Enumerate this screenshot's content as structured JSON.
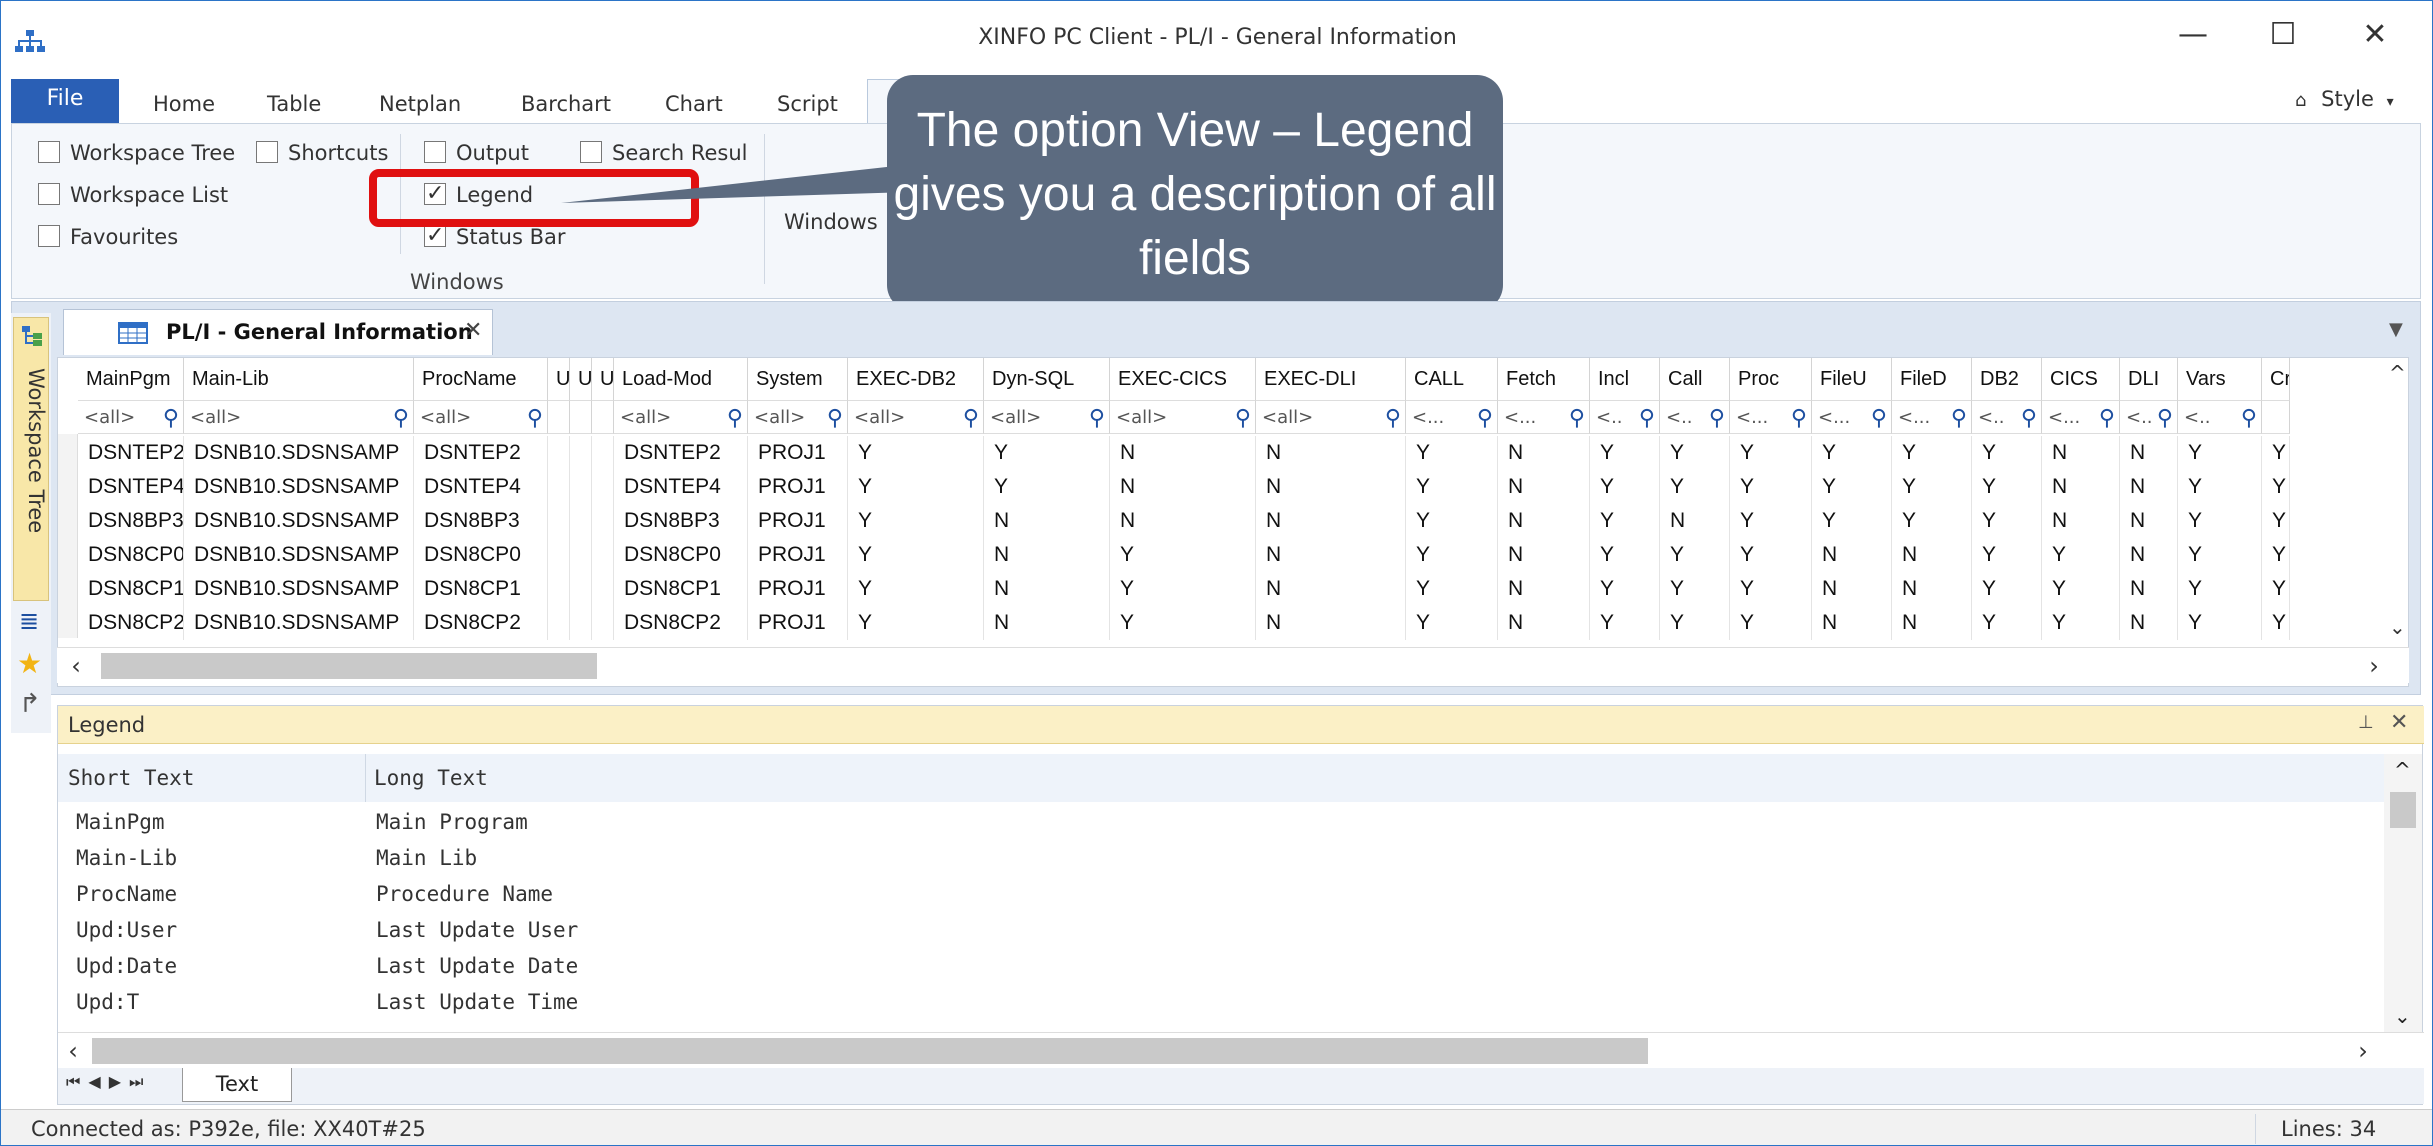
{
  "window": {
    "title": "XINFO PC Client - PL/I - General Information",
    "minimize": "—",
    "maximize": "☐",
    "close": "✕"
  },
  "ribbon_tabs": [
    "File",
    "Home",
    "Table",
    "Netplan",
    "Barchart",
    "Chart",
    "Script"
  ],
  "style_label": "Style",
  "ribbon": {
    "checkboxes": [
      {
        "label": "Workspace Tree",
        "checked": false
      },
      {
        "label": "Workspace List",
        "checked": false
      },
      {
        "label": "Favourites",
        "checked": false
      },
      {
        "label": "Shortcuts",
        "checked": false
      },
      {
        "label": "Output",
        "checked": false
      },
      {
        "label": "Legend",
        "checked": true
      },
      {
        "label": "Status Bar",
        "checked": true
      },
      {
        "label": "Search Resul",
        "checked": false
      }
    ],
    "group_label": "Windows",
    "windows_button": "Windows"
  },
  "callout": "The option View – Legend gives you a description of all fields",
  "side_tab": "Workspace Tree",
  "doc_tab": {
    "title": "PL/I - General Information",
    "close": "✕"
  },
  "grid": {
    "columns": [
      "MainPgm",
      "Main-Lib",
      "ProcName",
      "U",
      "U",
      "U",
      "Load-Mod",
      "System",
      "EXEC-DB2",
      "Dyn-SQL",
      "EXEC-CICS",
      "EXEC-DLI",
      "CALL",
      "Fetch",
      "Incl",
      "Call",
      "Proc",
      "FileU",
      "FileD",
      "DB2",
      "CICS",
      "DLI",
      "Vars",
      "Cr"
    ],
    "filters": [
      "<all>",
      "<all>",
      "<all>",
      "",
      "",
      "",
      "<all>",
      "<all>",
      "<all>",
      "<all>",
      "<all>",
      "<all>",
      "<...",
      "<...",
      "<..",
      "<..",
      "<...",
      "<...",
      "<...",
      "<..",
      "<...",
      "<..",
      "<..",
      ""
    ],
    "rows": [
      [
        "DSNTEP2",
        "DSNB10.SDSNSAMP",
        "DSNTEP2",
        "",
        "",
        "",
        "DSNTEP2",
        "PROJ1",
        "Y",
        "Y",
        "N",
        "N",
        "Y",
        "N",
        "Y",
        "Y",
        "Y",
        "Y",
        "Y",
        "Y",
        "N",
        "N",
        "Y",
        "Y"
      ],
      [
        "DSNTEP4",
        "DSNB10.SDSNSAMP",
        "DSNTEP4",
        "",
        "",
        "",
        "DSNTEP4",
        "PROJ1",
        "Y",
        "Y",
        "N",
        "N",
        "Y",
        "N",
        "Y",
        "Y",
        "Y",
        "Y",
        "Y",
        "Y",
        "N",
        "N",
        "Y",
        "Y"
      ],
      [
        "DSN8BP3",
        "DSNB10.SDSNSAMP",
        "DSN8BP3",
        "",
        "",
        "",
        "DSN8BP3",
        "PROJ1",
        "Y",
        "N",
        "N",
        "N",
        "Y",
        "N",
        "Y",
        "N",
        "Y",
        "Y",
        "Y",
        "Y",
        "N",
        "N",
        "Y",
        "Y"
      ],
      [
        "DSN8CP0",
        "DSNB10.SDSNSAMP",
        "DSN8CP0",
        "",
        "",
        "",
        "DSN8CP0",
        "PROJ1",
        "Y",
        "N",
        "Y",
        "N",
        "Y",
        "N",
        "Y",
        "Y",
        "Y",
        "N",
        "N",
        "Y",
        "Y",
        "N",
        "Y",
        "Y"
      ],
      [
        "DSN8CP1",
        "DSNB10.SDSNSAMP",
        "DSN8CP1",
        "",
        "",
        "",
        "DSN8CP1",
        "PROJ1",
        "Y",
        "N",
        "Y",
        "N",
        "Y",
        "N",
        "Y",
        "Y",
        "Y",
        "N",
        "N",
        "Y",
        "Y",
        "N",
        "Y",
        "Y"
      ],
      [
        "DSN8CP2",
        "DSNB10.SDSNSAMP",
        "DSN8CP2",
        "",
        "",
        "",
        "DSN8CP2",
        "PROJ1",
        "Y",
        "N",
        "Y",
        "N",
        "Y",
        "N",
        "Y",
        "Y",
        "Y",
        "N",
        "N",
        "Y",
        "Y",
        "N",
        "Y",
        "Y"
      ]
    ]
  },
  "legend": {
    "title": "Legend",
    "headers": [
      "Short Text",
      "Long Text"
    ],
    "rows": [
      [
        "MainPgm",
        "Main Program"
      ],
      [
        "Main-Lib",
        "Main Lib"
      ],
      [
        "ProcName",
        "Procedure Name"
      ],
      [
        "Upd:User",
        "Last Update User"
      ],
      [
        "Upd:Date",
        "Last Update Date"
      ],
      [
        "Upd:T",
        "Last Update Time"
      ]
    ],
    "sheet_tab": "Text"
  },
  "status": {
    "left": "Connected as: P392e, file: XX40T#25",
    "right": "Lines: 34"
  }
}
